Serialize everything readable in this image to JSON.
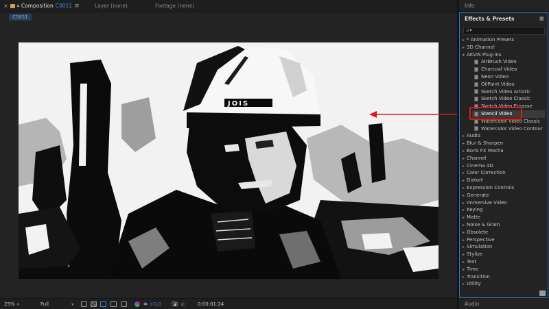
{
  "composition_panel": {
    "tab_composition_prefix": "Composition",
    "tab_composition_name": "C0051",
    "tab_layer": "Layer (none)",
    "tab_footage": "Footage (none)",
    "comp_chip": "C0051"
  },
  "viewer": {
    "description_icon": "stencil-preview-image"
  },
  "bottom_toolbar": {
    "zoom": "25%",
    "resolution": "Full",
    "exposure": "+0,0",
    "timecode": "0:00:01:24"
  },
  "info_panel": {
    "title": "Info"
  },
  "effects_panel": {
    "title": "Effects & Presets",
    "search_value": "⌕•",
    "items": [
      {
        "label": "* Animation Presets",
        "type": "category",
        "expanded": false
      },
      {
        "label": "3D Channel",
        "type": "category",
        "expanded": false
      },
      {
        "label": "AKVIS Plug-ins",
        "type": "category",
        "expanded": true
      },
      {
        "label": "AirBrush Video",
        "type": "effect"
      },
      {
        "label": "Charcoal Video",
        "type": "effect"
      },
      {
        "label": "Neon Video",
        "type": "effect"
      },
      {
        "label": "OilPaint Video",
        "type": "effect"
      },
      {
        "label": "Sketch Video Artistic",
        "type": "effect"
      },
      {
        "label": "Sketch Video Classic",
        "type": "effect"
      },
      {
        "label": "Sketch Video Ecrasse",
        "type": "effect"
      },
      {
        "label": "Stencil Video",
        "type": "effect",
        "selected": true
      },
      {
        "label": "Watercolor Video Classic",
        "type": "effect"
      },
      {
        "label": "Watercolor Video Contour",
        "type": "effect"
      },
      {
        "label": "Audio",
        "type": "category",
        "expanded": false
      },
      {
        "label": "Blur & Sharpen",
        "type": "category",
        "expanded": false
      },
      {
        "label": "Boris FX Mocha",
        "type": "category",
        "expanded": false
      },
      {
        "label": "Channel",
        "type": "category",
        "expanded": false
      },
      {
        "label": "Cinema 4D",
        "type": "category",
        "expanded": false
      },
      {
        "label": "Color Correction",
        "type": "category",
        "expanded": false
      },
      {
        "label": "Distort",
        "type": "category",
        "expanded": false
      },
      {
        "label": "Expression Controls",
        "type": "category",
        "expanded": false
      },
      {
        "label": "Generate",
        "type": "category",
        "expanded": false
      },
      {
        "label": "Immersive Video",
        "type": "category",
        "expanded": false
      },
      {
        "label": "Keying",
        "type": "category",
        "expanded": false
      },
      {
        "label": "Matte",
        "type": "category",
        "expanded": false
      },
      {
        "label": "Noise & Grain",
        "type": "category",
        "expanded": false
      },
      {
        "label": "Obsolete",
        "type": "category",
        "expanded": false
      },
      {
        "label": "Perspective",
        "type": "category",
        "expanded": false
      },
      {
        "label": "Simulation",
        "type": "category",
        "expanded": false
      },
      {
        "label": "Stylize",
        "type": "category",
        "expanded": false
      },
      {
        "label": "Text",
        "type": "category",
        "expanded": false
      },
      {
        "label": "Time",
        "type": "category",
        "expanded": false
      },
      {
        "label": "Transition",
        "type": "category",
        "expanded": false
      },
      {
        "label": "Utility",
        "type": "category",
        "expanded": false
      }
    ]
  },
  "audio_panel": {
    "title": "Audio"
  },
  "colors": {
    "accent_blue": "#3f8ee8",
    "annotation_red": "#e01818",
    "panel_bg": "#232323"
  }
}
